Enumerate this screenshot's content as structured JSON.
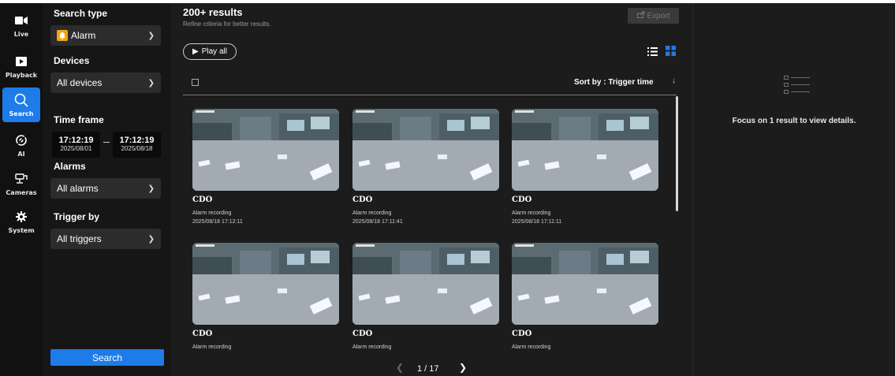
{
  "nav": {
    "items": [
      {
        "label": "Live",
        "icon": "video-camera-icon"
      },
      {
        "label": "Playback",
        "icon": "playback-icon"
      },
      {
        "label": "Search",
        "icon": "search-icon",
        "active": true
      },
      {
        "label": "AI",
        "icon": "ai-icon"
      },
      {
        "label": "Cameras",
        "icon": "cameras-icon"
      },
      {
        "label": "System",
        "icon": "gear-icon"
      }
    ]
  },
  "filters": {
    "search_type": {
      "title": "Search type",
      "value": "Alarm",
      "icon": "alarm-bell-icon"
    },
    "devices": {
      "title": "Devices",
      "value": "All devices"
    },
    "time_frame": {
      "title": "Time frame",
      "start": {
        "time": "17:12:19",
        "date": "2025/08/01"
      },
      "end": {
        "time": "17:12:19",
        "date": "2025/08/18"
      }
    },
    "alarms": {
      "title": "Alarms",
      "value": "All alarms"
    },
    "trigger_by": {
      "title": "Trigger by",
      "value": "All triggers"
    },
    "search_label": "Search"
  },
  "results": {
    "title": "200+ results",
    "subtitle": "Refine criteria for better results.",
    "export_label": "Export",
    "play_all_label": "Play all",
    "sort_label": "Sort by : Trigger time",
    "cards": [
      {
        "name": "CDO",
        "type": "Alarm recording",
        "time": "2025/08/18 17:12:11"
      },
      {
        "name": "CDO",
        "type": "Alarm recording",
        "time": "2025/08/18 17:11:41"
      },
      {
        "name": "CDO",
        "type": "Alarm recording",
        "time": "2025/08/18 17:11:11"
      },
      {
        "name": "CDO",
        "type": "Alarm recording",
        "time": ""
      },
      {
        "name": "CDO",
        "type": "Alarm recording",
        "time": ""
      },
      {
        "name": "CDO",
        "type": "Alarm recording",
        "time": ""
      }
    ],
    "pagination": {
      "text": "1 / 17"
    }
  },
  "details": {
    "message": "Focus on 1 result to view details."
  },
  "colors": {
    "accent": "#1e7ce8",
    "alarm": "#f2a60c",
    "background": "#1c1c1c",
    "panel": "#161616",
    "rail": "#111111"
  }
}
